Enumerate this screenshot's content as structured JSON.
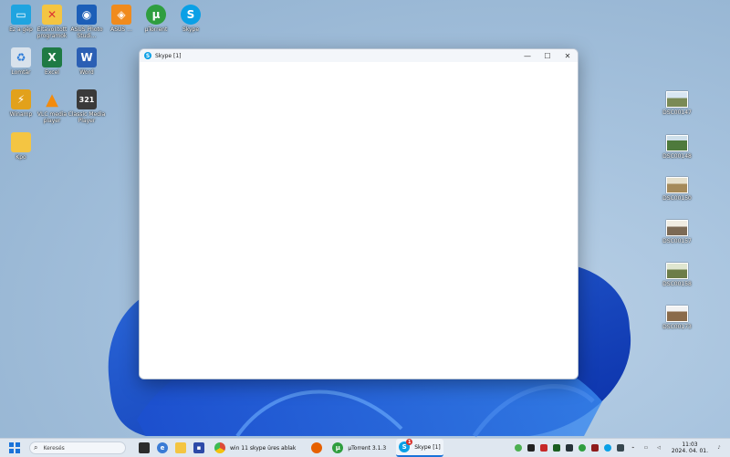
{
  "desktop": {
    "icons_left": [
      {
        "label": "Ez a gép",
        "icon": "computer-icon",
        "color": "#1fa4e0"
      },
      {
        "label": "Eltávolított programok",
        "icon": "folder-icon",
        "color": "#f4c542"
      },
      {
        "label": "ASUS Photo Studi...",
        "icon": "photo-app-icon",
        "color": "#1c5fb8"
      },
      {
        "label": "ASUS ...",
        "icon": "asus-icon",
        "color": "#f08b1d"
      },
      {
        "label": "µTorrent",
        "icon": "utorrent-icon",
        "color": "#2f9e3f"
      },
      {
        "label": "Skype",
        "icon": "skype-icon",
        "color": "#0aa0e6"
      },
      {
        "label": "Lomtár",
        "icon": "recycle-bin-icon",
        "color": "#d8e2ec"
      },
      {
        "label": "Excel",
        "icon": "excel-icon",
        "color": "#1f7a44"
      },
      {
        "label": "Word",
        "icon": "word-icon",
        "color": "#2b5fb4"
      },
      {
        "label": "Winamp",
        "icon": "winamp-icon",
        "color": "#e2a11b"
      },
      {
        "label": "VLC media player",
        "icon": "vlc-icon",
        "color": "#f38b0d"
      },
      {
        "label": "Classic Media Player",
        "icon": "media-player-icon",
        "color": "#3a3a3a"
      },
      {
        "label": "Kpo",
        "icon": "folder-icon",
        "color": "#f4c542"
      }
    ],
    "icons_right": [
      {
        "label": "DSC00147",
        "icon": "photo-thumbnail-icon",
        "color": "#7a8a55"
      },
      {
        "label": "DSC00148",
        "icon": "photo-thumbnail-icon",
        "color": "#4e7a3c"
      },
      {
        "label": "DSC00150",
        "icon": "photo-thumbnail-icon",
        "color": "#a58a5a"
      },
      {
        "label": "DSC00157",
        "icon": "photo-thumbnail-icon",
        "color": "#7c6a55"
      },
      {
        "label": "DSC00158",
        "icon": "photo-thumbnail-icon",
        "color": "#6d7d48"
      },
      {
        "label": "DSC00173",
        "icon": "photo-thumbnail-icon",
        "color": "#8a6b4a"
      }
    ]
  },
  "window": {
    "title": "Skype [1]",
    "minimize": "—",
    "maximize": "☐",
    "close": "✕"
  },
  "taskbar": {
    "search_placeholder": "Keresés",
    "apps": [
      {
        "label": "win 11 skype üres ablak",
        "icon": "chrome-icon",
        "color": "#dd4b39"
      },
      {
        "label": "µTorrent 3.1.3",
        "icon": "utorrent-icon",
        "color": "#2f9e3f"
      },
      {
        "label": "Skype [1]",
        "icon": "skype-icon",
        "color": "#0aa0e6",
        "badge": "1"
      }
    ],
    "clock_time": "11:03",
    "clock_date": "2024. 04. 01."
  }
}
